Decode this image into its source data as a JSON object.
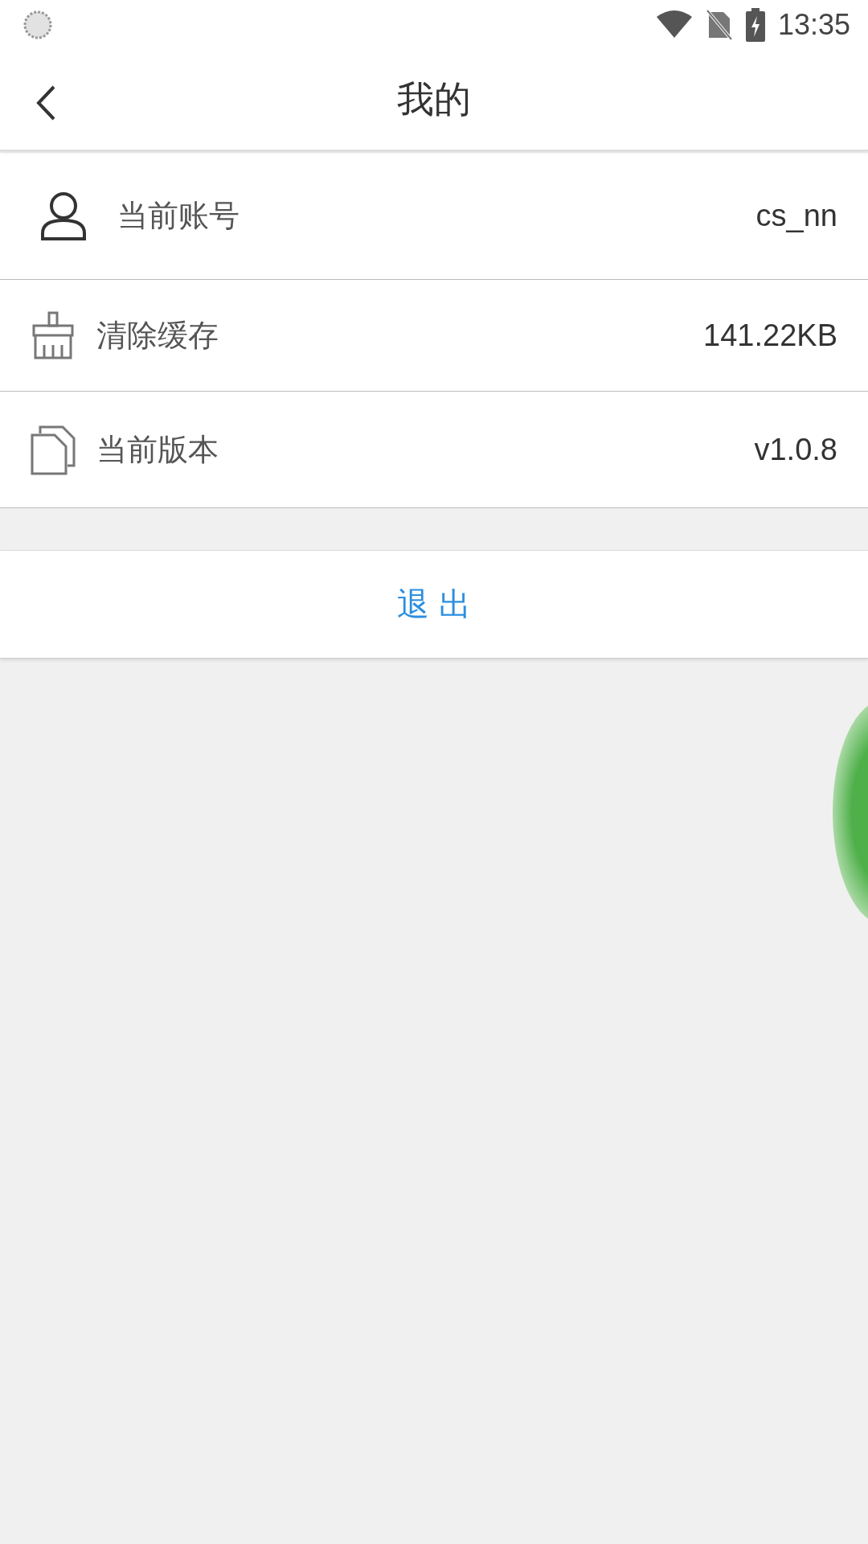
{
  "status_bar": {
    "time": "13:35"
  },
  "header": {
    "title": "我的"
  },
  "rows": [
    {
      "kind": "account",
      "label": "当前账号",
      "value": "cs_nn"
    },
    {
      "kind": "cache",
      "label": "清除缓存",
      "value": "141.22KB"
    },
    {
      "kind": "version",
      "label": "当前版本",
      "value": "v1.0.8"
    }
  ],
  "logout": {
    "label": "退 出"
  }
}
